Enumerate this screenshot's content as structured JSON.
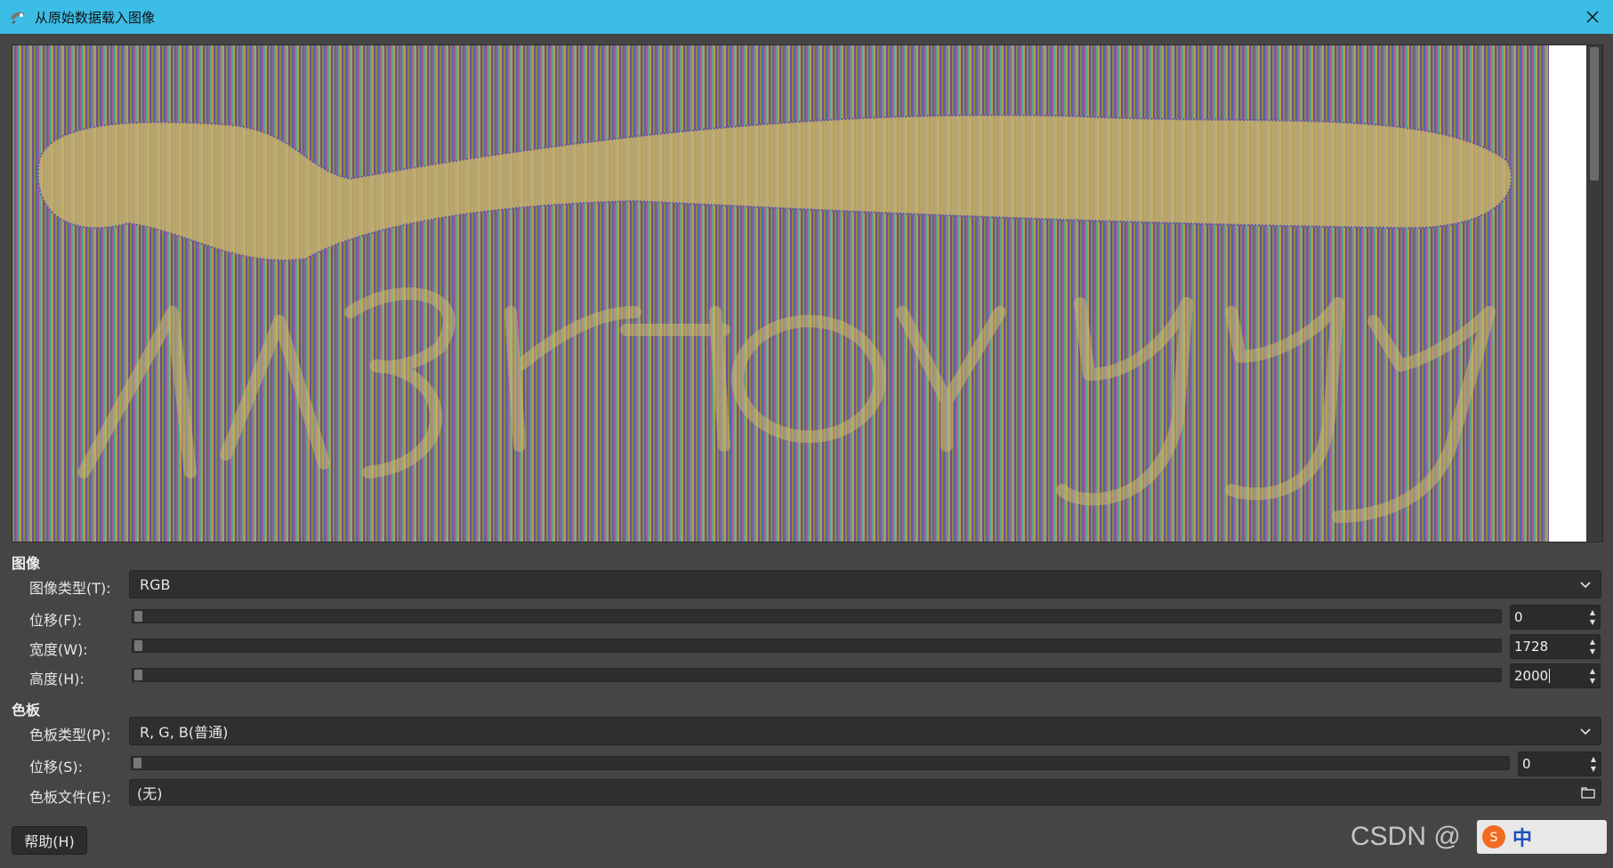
{
  "window": {
    "title": "从原始数据载入图像",
    "app_icon": "gimp-icon",
    "close_icon": "close-icon"
  },
  "image_section": {
    "heading": "图像",
    "type_label": "图像类型(T):",
    "type_value": "RGB",
    "offset_label": "位移(F):",
    "offset_value": "0",
    "width_label": "宽度(W):",
    "width_value": "1728",
    "height_label": "高度(H):",
    "height_value": "2000"
  },
  "palette_section": {
    "heading": "色板",
    "type_label": "色板类型(P):",
    "type_value": "R, G, B(普通)",
    "offset_label": "位移(S):",
    "offset_value": "0",
    "file_label": "色板文件(E):",
    "file_value": "(无)"
  },
  "buttons": {
    "help": "帮助(H)"
  },
  "watermark": {
    "text": "CSDN @",
    "logo_text": "中"
  },
  "colors": {
    "titlebar": "#3cbde6",
    "background": "#454545",
    "field": "#2f2f2f"
  }
}
